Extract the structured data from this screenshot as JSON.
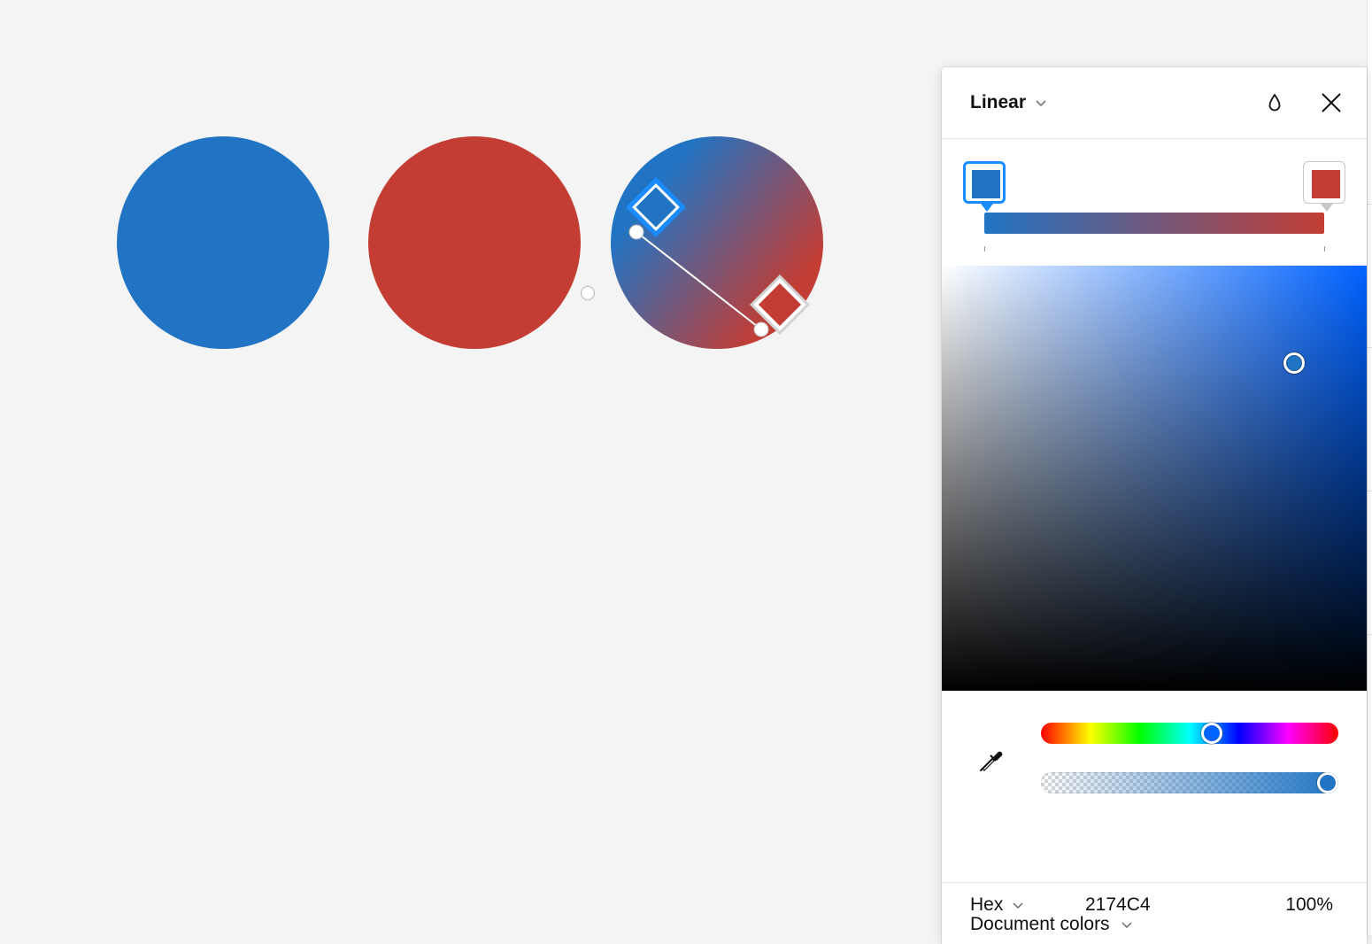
{
  "canvas": {
    "circles": [
      {
        "name": "blue-circle",
        "color": "#2174C4"
      },
      {
        "name": "red-circle",
        "color": "#C33D34"
      },
      {
        "name": "gradient-circle",
        "from": "#2174C4",
        "to": "#C33D34"
      }
    ]
  },
  "fill_picker": {
    "type_label": "Linear",
    "icons": {
      "blend": "drop-icon",
      "close": "close-icon",
      "type_menu": "chevron-down-icon",
      "eyedropper": "eyedropper-icon"
    },
    "gradient": {
      "stops": [
        {
          "color": "#2174C4",
          "position": 0,
          "selected": true
        },
        {
          "color": "#C33D34",
          "position": 1,
          "selected": false
        }
      ]
    },
    "picker": {
      "base_hue_color": "#0062FF",
      "saturation": 0.83,
      "brightness": 0.77,
      "hue_position": 0.58,
      "alpha": 1.0
    },
    "color_mode": "Hex",
    "hex_value": "2174C4",
    "opacity": "100%",
    "document_colors_label": "Document colors"
  }
}
